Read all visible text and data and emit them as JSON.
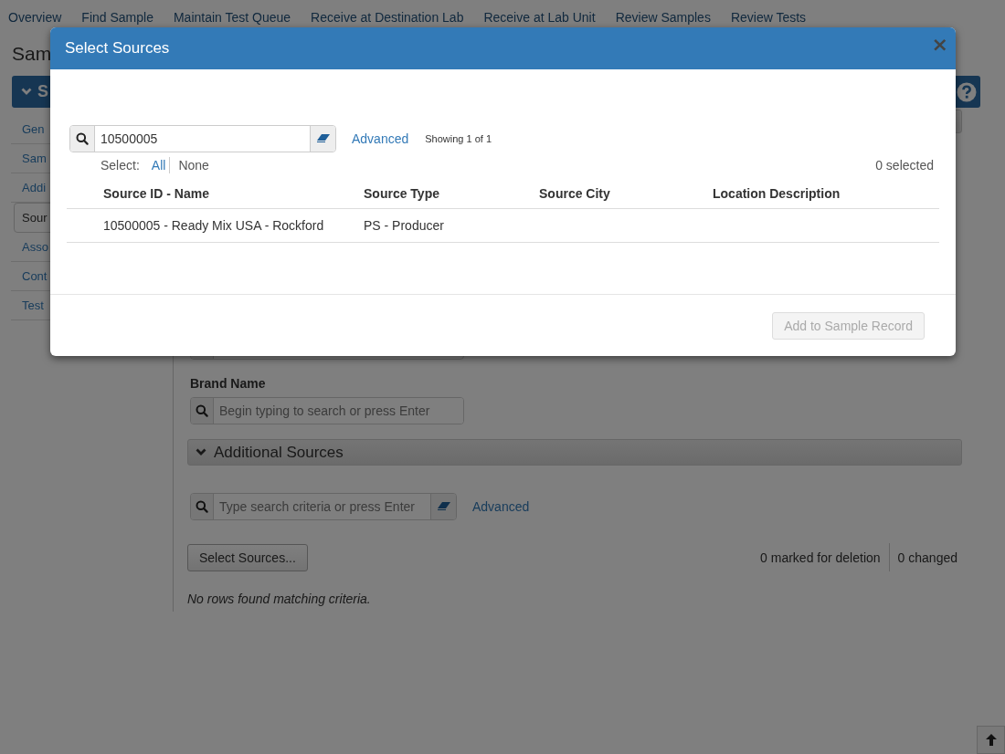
{
  "nav": [
    "Overview",
    "Find Sample",
    "Maintain Test Queue",
    "Receive at Destination Lab",
    "Receive at Lab Unit",
    "Review Samples",
    "Review Tests"
  ],
  "page_title": "Sam",
  "section_bar": {
    "label": "S",
    "expanded": true
  },
  "sidebar": {
    "items": [
      {
        "label": "Gen",
        "selected": false
      },
      {
        "label": "Sam",
        "selected": false
      },
      {
        "label": "Addi",
        "selected": false
      },
      {
        "label": "Sour",
        "selected": true
      },
      {
        "label": "Asso",
        "selected": false
      },
      {
        "label": "Cont",
        "selected": false
      },
      {
        "label": "Test",
        "selected": false
      }
    ]
  },
  "content": {
    "brand_label": "Brand Name",
    "brand_placeholder": "Begin typing to search or press Enter",
    "additional_sources": {
      "title": "Additional Sources",
      "expanded": true
    },
    "search_placeholder": "Type search criteria or press Enter",
    "advanced": "Advanced",
    "select_button": "Select Sources...",
    "marked": "0 marked for deletion",
    "changed": "0 changed",
    "empty": "No rows found matching criteria."
  },
  "modal": {
    "title": "Select Sources",
    "close": "×",
    "search_value": "10500005",
    "advanced": "Advanced",
    "showing": "Showing 1 of 1",
    "select_label": "Select:",
    "select_all": "All",
    "select_none": "None",
    "selected_count": "0 selected",
    "columns": [
      "Source ID - Name",
      "Source Type",
      "Source City",
      "Location Description"
    ],
    "rows": [
      [
        "10500005 - Ready Mix USA - Rockford",
        "PS - Producer"
      ]
    ],
    "add_button": {
      "label": "Add to Sample Record",
      "disabled": true
    }
  }
}
